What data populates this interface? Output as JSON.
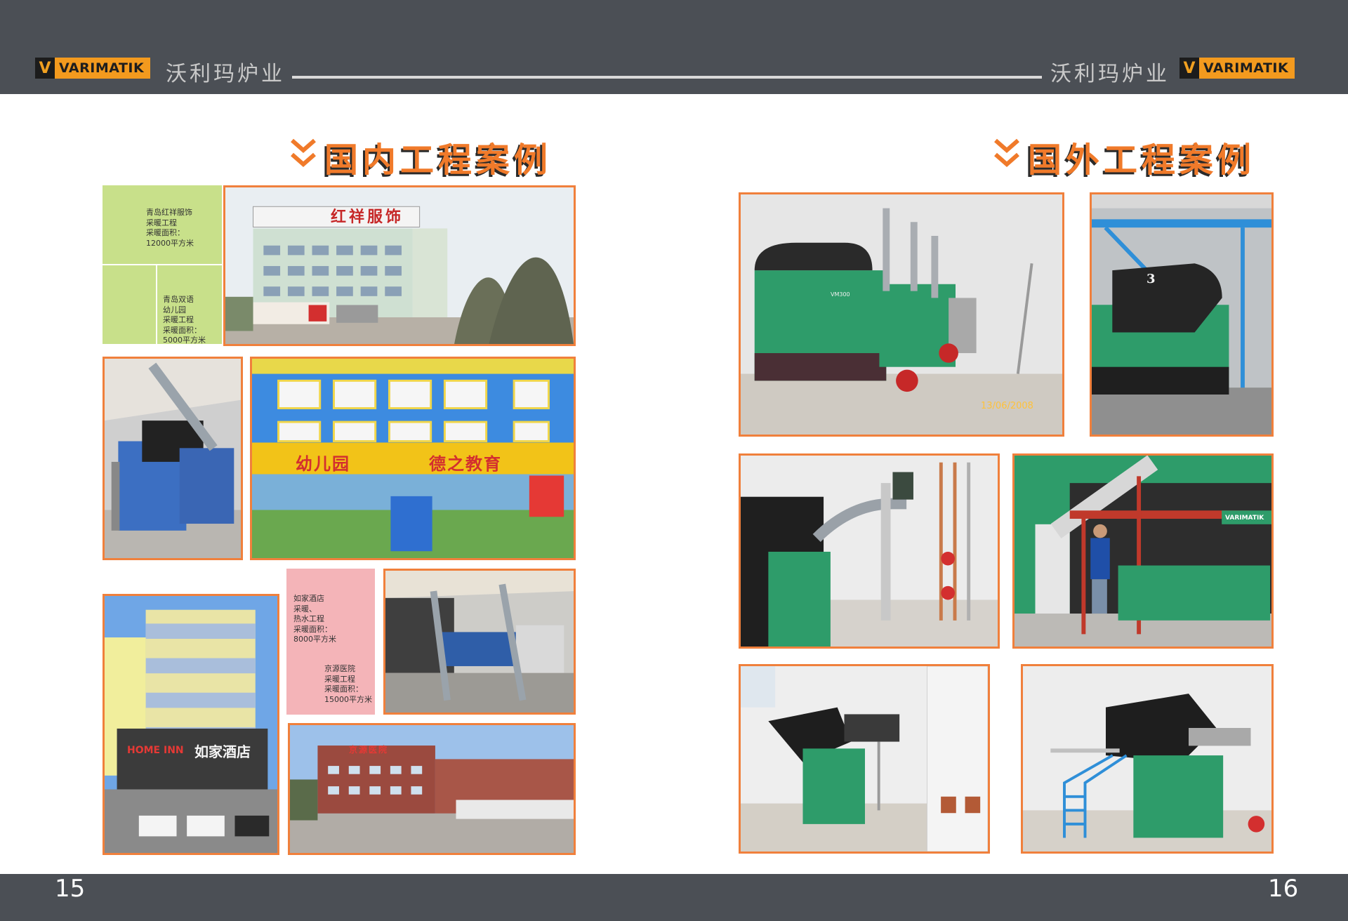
{
  "header": {
    "logo_mark": "V",
    "logo_text": "VARIMATIK",
    "brand_left": "沃利玛炉业",
    "brand_right": "沃利玛炉业"
  },
  "left_page": {
    "heading": "国内工程案例",
    "captions": {
      "hongxiang": "青岛红祥服饰\n采暖工程\n采暖面积：\n12000平方米",
      "kindergarten": "青岛双语\n幼儿园\n采暖工程\n采暖面积：\n5000平方米",
      "hotel": "如家酒店\n采暖、\n热水工程\n采暖面积：\n8000平方米",
      "hospital": "京源医院\n采暖工程\n采暖面积：\n15000平方米"
    },
    "signs": {
      "hongxiang": "红祥服饰",
      "kindergarten": "幼儿园",
      "education": "德之教育",
      "hotel_brand": "HOME INN",
      "hotel_name": "如家酒店",
      "hospital": "京源医院"
    },
    "page_number": "15"
  },
  "right_page": {
    "heading": "国外工程案例",
    "signs": {
      "photo_date": "13/06/2008",
      "boiler_model": "VM300",
      "boiler_number": "3",
      "wall_logo": "VARIMATIK"
    },
    "page_number": "16"
  },
  "colors": {
    "bar": "#4b4f55",
    "accent": "#f07a2a",
    "photo_border": "#f0803c",
    "caption_green": "#c8e08a",
    "caption_pink": "#f4b4b8",
    "boiler_green": "#2e9c6a"
  }
}
